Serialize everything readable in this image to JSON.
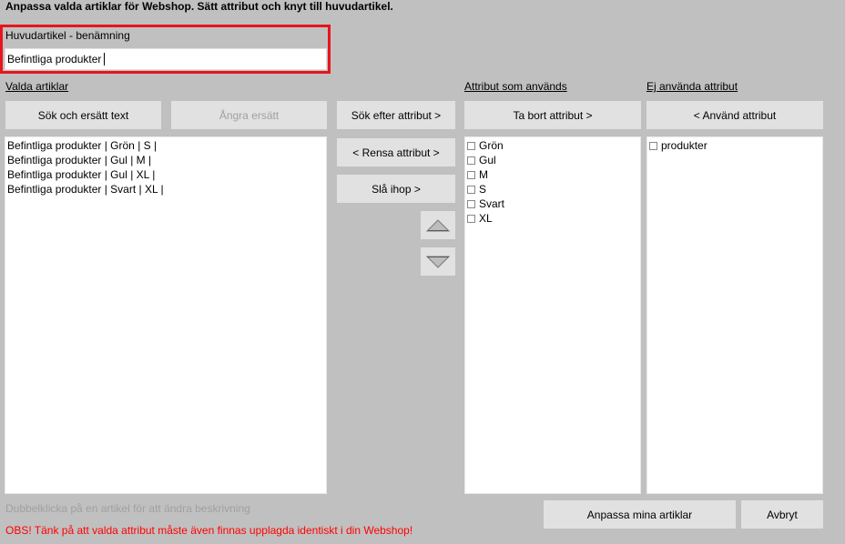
{
  "header": {
    "title": "Anpassa valda artiklar för Webshop. Sätt attribut och knyt till huvudartikel."
  },
  "main_article": {
    "label": "Huvudartikel - benämning",
    "value": "Befintliga produkter"
  },
  "selected_articles": {
    "label": "Valda artiklar",
    "search_replace_label": "Sök och ersätt text",
    "undo_replace_label": "Ångra ersätt",
    "items": [
      "Befintliga produkter | Grön | S |",
      "Befintliga produkter | Gul | M |",
      "Befintliga produkter | Gul | XL |",
      "Befintliga produkter | Svart | XL |"
    ]
  },
  "middle_buttons": {
    "search_attributes": "Sök efter attribut >",
    "clear_attributes": "< Rensa attribut >",
    "merge": "Slå ihop >"
  },
  "used_attributes": {
    "label": "Attribut som används",
    "remove_label": "Ta bort attribut >",
    "items": [
      "Grön",
      "Gul",
      "M",
      "S",
      "Svart",
      "XL"
    ]
  },
  "unused_attributes": {
    "label": "Ej använda attribut",
    "use_label": "< Använd attribut",
    "items": [
      "produkter"
    ]
  },
  "footer": {
    "hint": "Dubbelklicka på en artikel för att ändra beskrivning",
    "warning": "OBS! Tänk på att valda attribut måste även finnas upplagda identiskt i din Webshop!",
    "customize_label": "Anpassa mina artiklar",
    "cancel_label": "Avbryt"
  },
  "colors": {
    "background": "#c0c0c0",
    "button": "#e1e1e1",
    "highlight_border": "#e8141e",
    "warning_text": "#ff0000",
    "hint_text": "#a0a0a0"
  },
  "icons": {
    "move_up": "triangle-up-icon",
    "move_down": "triangle-down-icon"
  }
}
